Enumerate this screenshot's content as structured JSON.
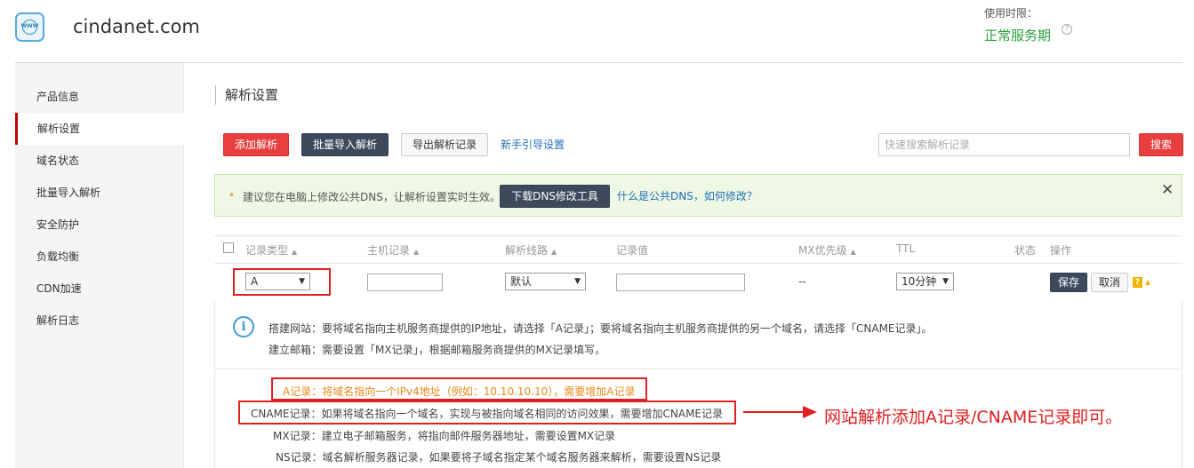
{
  "header": {
    "logo_text": "WWW",
    "domain": "cindanet.com",
    "usage_label": "使用时限：",
    "usage_value": "正常服务期",
    "help_icon": "?"
  },
  "sidebar": {
    "items": [
      {
        "label": "产品信息",
        "active": false
      },
      {
        "label": "解析设置",
        "active": true
      },
      {
        "label": "域名状态",
        "active": false
      },
      {
        "label": "批量导入解析",
        "active": false
      },
      {
        "label": "安全防护",
        "active": false
      },
      {
        "label": "负载均衡",
        "active": false
      },
      {
        "label": "CDN加速",
        "active": false
      },
      {
        "label": "解析日志",
        "active": false
      }
    ]
  },
  "main": {
    "title": "解析设置",
    "toolbar": {
      "add": "添加解析",
      "batch_import": "批量导入解析",
      "export": "导出解析记录",
      "guide": "新手引导设置",
      "search_placeholder": "快速搜索解析记录",
      "search": "搜索"
    },
    "notice": {
      "bullet": "•",
      "text": "建议您在电脑上修改公共DNS，让解析设置实时生效。",
      "download_button": "下载DNS修改工具",
      "link": "什么是公共DNS，如何修改？",
      "close": "✕"
    },
    "table": {
      "headers": {
        "type": "记录类型",
        "host": "主机记录",
        "line": "解析线路",
        "value": "记录值",
        "mx": "MX优先级",
        "ttl": "TTL",
        "status": "状态",
        "action": "操作"
      },
      "sort_icon": "▲",
      "edit_row": {
        "type_value": "A",
        "host_value": "",
        "line_value": "默认",
        "record_value": "",
        "mx_value": "--",
        "ttl_value": "10分钟",
        "save": "保存",
        "cancel": "取消",
        "help_badge": "?",
        "collapse_icon": "▲",
        "caret": "▼"
      }
    },
    "info": {
      "icon": "i",
      "line1_label": "搭建网站：",
      "line1_text": "要将域名指向主机服务商提供的IP地址，请选择「A记录」；要将域名指向主机服务商提供的另一个域名，请选择「CNAME记录」。",
      "line2_label": "建立邮箱：",
      "line2_text": "需要设置「MX记录」，根据邮箱服务商提供的MX记录填写。"
    },
    "records": {
      "a": "A记录：将域名指向一个IPv4地址（例如：10.10.10.10），需要增加A记录",
      "cname": "CNAME记录：如果将域名指向一个域名，实现与被指向域名相同的访问效果，需要增加CNAME记录",
      "mx": "MX记录：建立电子邮箱服务，将指向邮件服务器地址，需要设置MX记录",
      "ns": "NS记录：域名解析服务器记录，如果要将子域名指定某个域名服务器来解析，需要设置NS记录"
    },
    "annotation": "网站解析添加A记录/CNAME记录即可。"
  },
  "colors": {
    "accent_red": "#e73e3e",
    "dark_button": "#3c4a5c",
    "link_blue": "#1f6fb5",
    "status_green": "#2aa03c",
    "annotation_red": "#e02020",
    "highlight_orange": "#e88a1a"
  },
  "icons": {
    "logo": "www-globe-icon",
    "help": "question-circle-icon",
    "close": "close-icon",
    "info": "info-circle-icon",
    "sort": "sort-up-icon",
    "arrow": "arrow-right-icon"
  }
}
